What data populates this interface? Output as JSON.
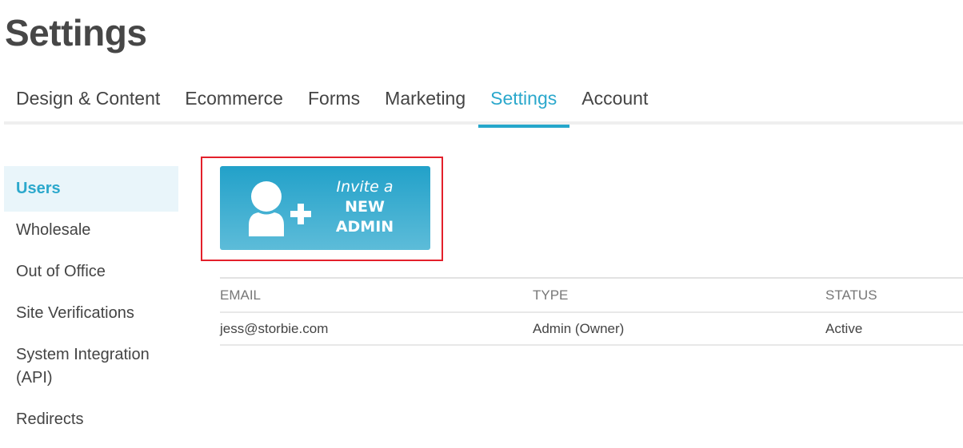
{
  "page": {
    "title": "Settings"
  },
  "tabs": [
    {
      "label": "Design & Content",
      "active": false
    },
    {
      "label": "Ecommerce",
      "active": false
    },
    {
      "label": "Forms",
      "active": false
    },
    {
      "label": "Marketing",
      "active": false
    },
    {
      "label": "Settings",
      "active": true
    },
    {
      "label": "Account",
      "active": false
    }
  ],
  "sidebar": {
    "items": [
      {
        "label": "Users",
        "active": true
      },
      {
        "label": "Wholesale",
        "active": false
      },
      {
        "label": "Out of Office",
        "active": false
      },
      {
        "label": "Site Verifications",
        "active": false
      },
      {
        "label": "System Integration (API)",
        "active": false
      },
      {
        "label": "Redirects",
        "active": false
      }
    ]
  },
  "invite_button": {
    "icon": "add-user-icon",
    "line1": "Invite a",
    "line2": "NEW",
    "line3": "ADMIN",
    "highlight_color": "#e3202b"
  },
  "users_table": {
    "columns": [
      "EMAIL",
      "TYPE",
      "STATUS"
    ],
    "rows": [
      {
        "email": "jess@storbie.com",
        "type": "Admin (Owner)",
        "status": "Active"
      }
    ]
  },
  "colors": {
    "accent": "#2ba8cc",
    "active_sidebar_bg": "#e9f5fa",
    "button_gradient_top": "#22a1c9",
    "button_gradient_bottom": "#5dbcd9"
  }
}
